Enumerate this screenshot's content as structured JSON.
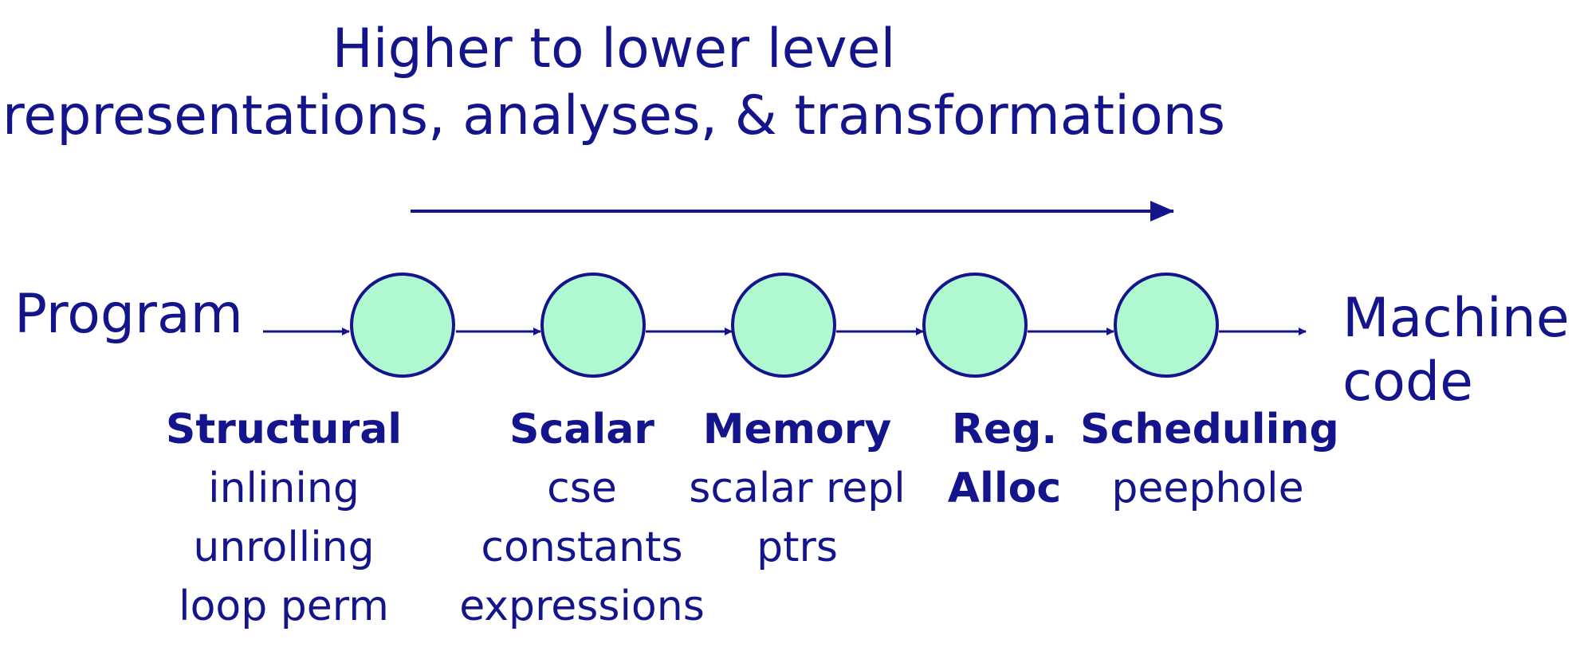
{
  "title": {
    "line1": "Higher to lower level",
    "line2": "representations, analyses, & transformations"
  },
  "input_label": "Program",
  "output_label": {
    "line1": "Machine",
    "line2": "code"
  },
  "stages": [
    {
      "heading": "Structural",
      "items": [
        "inlining",
        "unrolling",
        "loop perm"
      ]
    },
    {
      "heading": "Scalar",
      "items": [
        "cse",
        "constants",
        "expressions"
      ]
    },
    {
      "heading": "Memory",
      "items": [
        "scalar repl",
        "ptrs"
      ]
    },
    {
      "heading": "Reg.",
      "items": [
        "Alloc"
      ]
    },
    {
      "heading": "Scheduling",
      "items": [
        "peephole"
      ]
    }
  ],
  "colors": {
    "text": "#14148c",
    "node_fill": "#b0f8d0",
    "node_stroke": "#14148c",
    "arrow": "#14148c"
  }
}
